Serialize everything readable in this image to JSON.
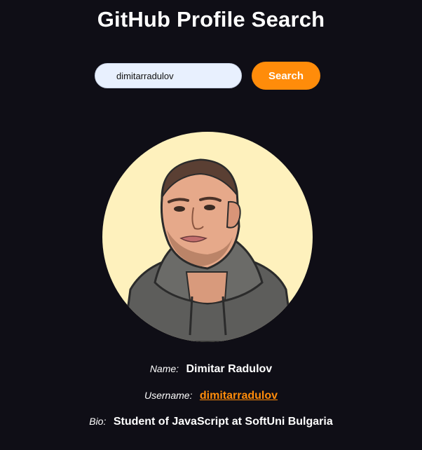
{
  "header": {
    "title": "GitHub Profile Search"
  },
  "search": {
    "value": "dimitarradulov",
    "button_label": "Search"
  },
  "profile": {
    "name_label": "Name:",
    "name": "Dimitar Radulov",
    "username_label": "Username:",
    "username": "dimitarradulov",
    "bio_label": "Bio:",
    "bio": "Student of JavaScript at SoftUni Bulgaria"
  },
  "colors": {
    "background": "#0f0e16",
    "accent": "#ff8c0a",
    "avatar_background": "#fef1bd"
  }
}
